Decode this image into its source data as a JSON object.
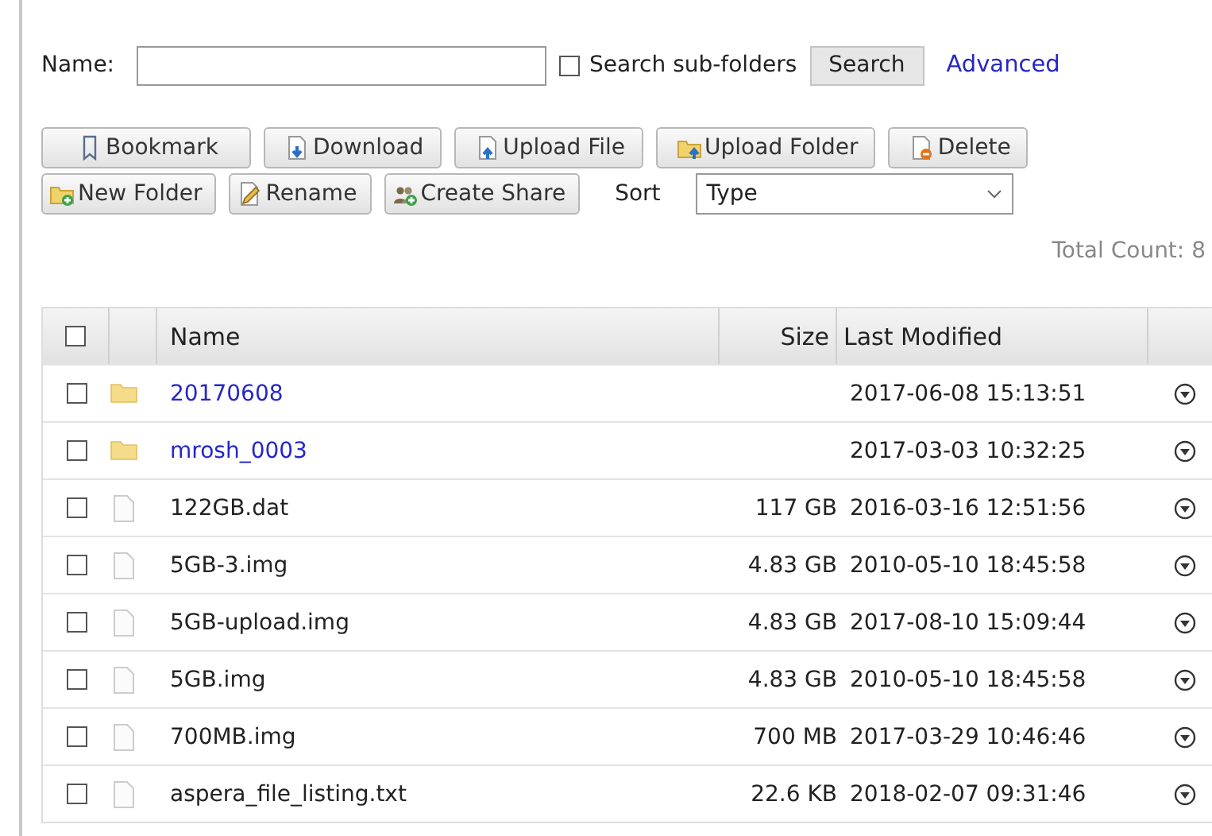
{
  "search": {
    "label": "Name:",
    "subfolders": {
      "label": "Search sub-folders",
      "checked": false
    },
    "button": "Search",
    "advanced": "Advanced"
  },
  "toolbar": [
    [
      {
        "kind": "bookmark",
        "label": "Bookmark"
      },
      {
        "kind": "download",
        "label": "Download"
      },
      {
        "kind": "upload-file",
        "label": "Upload File"
      },
      {
        "kind": "upload-folder",
        "label": "Upload Folder"
      },
      {
        "kind": "delete",
        "label": "Delete"
      }
    ],
    [
      {
        "kind": "new-folder",
        "label": "New Folder"
      },
      {
        "kind": "rename",
        "label": "Rename"
      },
      {
        "kind": "create-share",
        "label": "Create Share"
      }
    ]
  ],
  "sort": {
    "label": "Sort",
    "value": "Type"
  },
  "total_count": "Total Count: 8",
  "table": {
    "select_all": {
      "checked": false
    },
    "columns": [
      "Name",
      "Size",
      "Last Modified"
    ],
    "rows": [
      {
        "kind": "folder",
        "name": "20170608",
        "size": "",
        "modified": "2017-06-08 15:13:51",
        "checked": false
      },
      {
        "kind": "folder",
        "name": "mrosh_0003",
        "size": "",
        "modified": "2017-03-03 10:32:25",
        "checked": false
      },
      {
        "kind": "file",
        "name": "122GB.dat",
        "size": "117 GB",
        "modified": "2016-03-16 12:51:56",
        "checked": false
      },
      {
        "kind": "file",
        "name": "5GB-3.img",
        "size": "4.83 GB",
        "modified": "2010-05-10 18:45:58",
        "checked": false
      },
      {
        "kind": "file",
        "name": "5GB-upload.img",
        "size": "4.83 GB",
        "modified": "2017-08-10 15:09:44",
        "checked": false
      },
      {
        "kind": "file",
        "name": "5GB.img",
        "size": "4.83 GB",
        "modified": "2010-05-10 18:45:58",
        "checked": false
      },
      {
        "kind": "file",
        "name": "700MB.img",
        "size": "700 MB",
        "modified": "2017-03-29 10:46:46",
        "checked": false
      },
      {
        "kind": "file",
        "name": "aspera_file_listing.txt",
        "size": "22.6 KB",
        "modified": "2018-02-07 09:31:46",
        "checked": false
      }
    ]
  }
}
